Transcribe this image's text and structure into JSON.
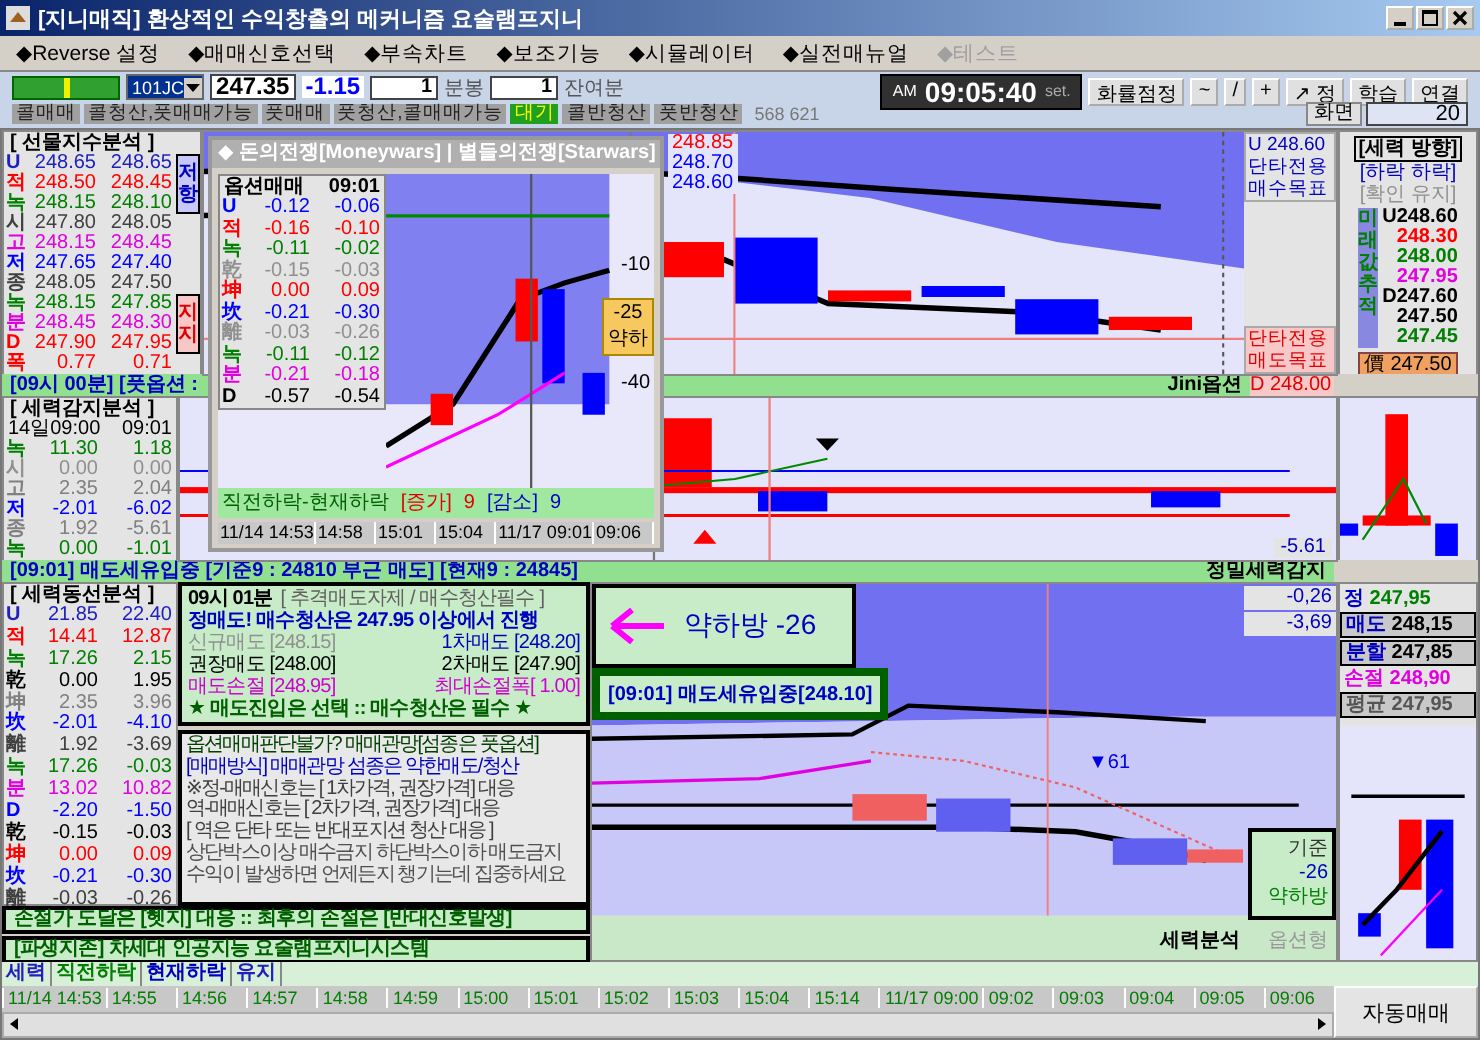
{
  "window": {
    "title": "[지니매직] 환상적인 수익창출의 메커니즘 요술램프지니"
  },
  "menu": [
    {
      "label": "◆Reverse 설정",
      "disabled": false
    },
    {
      "label": "◆매매신호선택",
      "disabled": false
    },
    {
      "label": "◆부속차트",
      "disabled": false
    },
    {
      "label": "◆보조기능",
      "disabled": false
    },
    {
      "label": "◆시뮬레이터",
      "disabled": false
    },
    {
      "label": "◆실전매뉴얼",
      "disabled": false
    },
    {
      "label": "◆테스트",
      "disabled": true
    }
  ],
  "toolbar": {
    "code": "101JC",
    "price": "247.35",
    "change": "-1.15",
    "bar_value": "1",
    "bar_label": "분봉",
    "remain_value": "1",
    "remain_label": "잔여분",
    "clock": {
      "ampm": "AM",
      "time": "09:05:40",
      "set": "set."
    },
    "buttons": [
      "화률점정",
      "~",
      "/",
      "+",
      "↗ 정",
      "학습",
      "연결"
    ]
  },
  "signals": [
    {
      "label": "콜매매",
      "selected": false
    },
    {
      "label": "콜청산,풋매매가능",
      "selected": false
    },
    {
      "label": "풋매매",
      "selected": false
    },
    {
      "label": "풋청산,콜매매가능",
      "selected": false
    },
    {
      "label": "대기",
      "selected": true
    },
    {
      "label": "콜반청산",
      "selected": false
    },
    {
      "label": "풋반청산",
      "selected": false
    }
  ],
  "signal_code": "568 621",
  "screen": {
    "label": "화면",
    "value": "20"
  },
  "futures_panel": {
    "title": "[ 선물지수분석 ]",
    "rows": [
      {
        "label": "U",
        "a": "248.65",
        "b": "248.65",
        "color": "#2020c0"
      },
      {
        "label": "적",
        "a": "248.50",
        "b": "248.45",
        "color": "#ff0000"
      },
      {
        "label": "녹",
        "a": "248.15",
        "b": "248.10",
        "color": "#008000"
      },
      {
        "label": "시",
        "a": "247.80",
        "b": "248.05",
        "color": "#404040"
      },
      {
        "label": "고",
        "a": "248.15",
        "b": "248.45",
        "color": "#e000e0"
      },
      {
        "label": "저",
        "a": "247.65",
        "b": "247.40",
        "color": "#0000ff"
      },
      {
        "label": "종",
        "a": "248.05",
        "b": "247.50",
        "color": "#404040"
      },
      {
        "label": "녹",
        "a": "248.15",
        "b": "247.85",
        "color": "#008000"
      },
      {
        "label": "분",
        "a": "248.45",
        "b": "248.30",
        "color": "#e000e0"
      },
      {
        "label": "D",
        "a": "247.90",
        "b": "247.95",
        "color": "#ff0000"
      },
      {
        "label": "폭",
        "a": "0.77",
        "b": "0.71",
        "color": "#ff0000"
      }
    ],
    "side_tags": [
      {
        "text": "저항",
        "kind": "resistance"
      },
      {
        "text": "지지",
        "kind": "support"
      }
    ]
  },
  "popup": {
    "title": "◆ 돈의전쟁[Moneywars] | 별들의전쟁[Starwars]",
    "head": {
      "label": "옵션매매",
      "time": "09:01"
    },
    "rows": [
      {
        "label": "U",
        "a": "-0.12",
        "b": "-0.06",
        "color": "#0000ff"
      },
      {
        "label": "적",
        "a": "-0.16",
        "b": "-0.10",
        "color": "#ff0000"
      },
      {
        "label": "녹",
        "a": "-0.11",
        "b": "-0.02",
        "color": "#008000"
      },
      {
        "label": "乾",
        "a": "-0.15",
        "b": "-0.03",
        "color": "#909090"
      },
      {
        "label": "坤",
        "a": "0.00",
        "b": "0.09",
        "color": "#ff0000"
      },
      {
        "label": "坎",
        "a": "-0.21",
        "b": "-0.30",
        "color": "#0000ff"
      },
      {
        "label": "離",
        "a": "-0.03",
        "b": "-0.26",
        "color": "#909090"
      },
      {
        "label": "녹",
        "a": "-0.11",
        "b": "-0.12",
        "color": "#008000"
      },
      {
        "label": "분",
        "a": "-0.21",
        "b": "-0.18",
        "color": "#e000e0"
      },
      {
        "label": "D",
        "a": "-0.57",
        "b": "-0.54",
        "color": "#000000"
      }
    ],
    "axis_labels": [
      "-10",
      "-40"
    ],
    "badge": {
      "value": "-25",
      "text": "약하"
    },
    "summary": {
      "text": "직전하락-현재하락",
      "up_label": "[증가]",
      "up_count": "9",
      "down_label": "[감소]",
      "down_count": "9"
    },
    "times": [
      "11/14 14:53",
      "14:58",
      "15:01",
      "15:04",
      "11/17 09:01",
      "09:06"
    ]
  },
  "main_chart": {
    "price_labels": [
      {
        "text": "248.85",
        "color": "#ff0000"
      },
      {
        "text": "248.70",
        "color": "#0000ff"
      },
      {
        "text": "248.60",
        "color": "#0000ff"
      }
    ],
    "targets_top": [
      "U 248.60",
      "단타전용",
      "매수목표"
    ],
    "targets_bottom": [
      "단타전용",
      "매도목표"
    ],
    "strip_left": "[09시 00분] [풋옵션 :",
    "strip_right": "Jini옵션",
    "bottom_target": "D 248.00"
  },
  "direction_panel": {
    "title": "[세력 방향]",
    "line1": "[하락 하락]",
    "line2": "[확인 유지]",
    "vertical": "미래값추적",
    "values": [
      {
        "text": "U248.60",
        "color": "#000000"
      },
      {
        "text": "248.30",
        "color": "#ff0000"
      },
      {
        "text": "248.00",
        "color": "#008000"
      },
      {
        "text": "247.95",
        "color": "#e000e0"
      },
      {
        "text": "D247.60",
        "color": "#000000"
      },
      {
        "text": "247.50",
        "color": "#000000"
      },
      {
        "text": "247.45",
        "color": "#008000"
      }
    ],
    "price_icon": "價",
    "price": "247.50"
  },
  "force_panel": {
    "title": "[ 세력감지분석 ]",
    "head": {
      "date": "14일09:00",
      "time": "09:01"
    },
    "rows": [
      {
        "label": "녹",
        "a": "11.30",
        "b": "1.18",
        "color": "#008000"
      },
      {
        "label": "시",
        "a": "0.00",
        "b": "0.00",
        "color": "#909090"
      },
      {
        "label": "고",
        "a": "2.35",
        "b": "2.04",
        "color": "#808080"
      },
      {
        "label": "저",
        "a": "-2.01",
        "b": "-6.02",
        "color": "#0000ff"
      },
      {
        "label": "종",
        "a": "1.92",
        "b": "-5.61",
        "color": "#808080"
      },
      {
        "label": "녹",
        "a": "0.00",
        "b": "-1.01",
        "color": "#008000"
      }
    ]
  },
  "force_chart": {
    "reading": "-5.61"
  },
  "alert_strip": {
    "text": "[09:01] 매도세유입중 [기준9 : 24810 부근 매도] [현재9 : 24845]",
    "label": "정밀세력감지"
  },
  "flow_panel": {
    "title": "[ 세력동선분석 ]",
    "rows": [
      {
        "label": "U",
        "a": "21.85",
        "b": "22.40",
        "color": "#2020c0"
      },
      {
        "label": "적",
        "a": "14.41",
        "b": "12.87",
        "color": "#ff0000"
      },
      {
        "label": "녹",
        "a": "17.26",
        "b": "2.15",
        "color": "#008000"
      },
      {
        "label": "乾",
        "a": "0.00",
        "b": "1.95",
        "color": "#000000"
      },
      {
        "label": "坤",
        "a": "2.35",
        "b": "3.96",
        "color": "#808080"
      },
      {
        "label": "坎",
        "a": "-2.01",
        "b": "-4.10",
        "color": "#0000ff"
      },
      {
        "label": "離",
        "a": "1.92",
        "b": "-3.69",
        "color": "#404040"
      },
      {
        "label": "녹",
        "a": "17.26",
        "b": "-0.03",
        "color": "#008000"
      },
      {
        "label": "분",
        "a": "13.02",
        "b": "10.82",
        "color": "#e000e0"
      },
      {
        "label": "D",
        "a": "-2.20",
        "b": "-1.50",
        "color": "#0000ff"
      },
      {
        "label": "乾",
        "a": "-0.15",
        "b": "-0.03",
        "color": "#000000"
      },
      {
        "label": "坤",
        "a": "0.00",
        "b": "0.09",
        "color": "#ff0000"
      },
      {
        "label": "坎",
        "a": "-0.21",
        "b": "-0.30",
        "color": "#0000ff"
      },
      {
        "label": "離",
        "a": "-0.03",
        "b": "-0.26",
        "color": "#404040"
      }
    ]
  },
  "advice": {
    "time": "09시 01분",
    "note": "[ 추격매도자제 / 매수청산필수 ]",
    "main": "정매도! 매수청산은 247.95 이상에서 진행",
    "prices": [
      {
        "left": "신규매도 [248.15]",
        "right": "1차매도 [248.20]",
        "color": "#909090"
      },
      {
        "left": "권장매도 [248.00]",
        "right": "2차매도 [247.90]",
        "color": "#000000"
      },
      {
        "left": "매도손절 [248.95]",
        "right": "최대손절폭[ 1.00]",
        "color": "#d000d0"
      }
    ],
    "slogan": "★ 매도진입은 선택 :: 매수청산은 필수 ★"
  },
  "guide": [
    {
      "text": "옵션매매판단불가? 매매관망[섬종은 풋옵션]",
      "color": "#004000"
    },
    {
      "text": "[매매방식] 매매관망 섬종은 약한매도/청산",
      "color": "#0000c0"
    },
    {
      "text": "※정-매매신호는 [ 1차가격, 권장가격] 대응",
      "color": "#404040"
    },
    {
      "text": "역-매매신호는 [ 2차가격, 권장가격] 대응",
      "color": "#404040"
    },
    {
      "text": "[ 역은 단타 또는 반대포지션 청산 대응 ]",
      "color": "#404040"
    },
    {
      "text": "상단박스이상 매수금지  하단박스이하 매도금지",
      "color": "#505050"
    },
    {
      "text": "수익이 발생하면 언제든지 챙기는데 집중하세요",
      "color": "#505050"
    }
  ],
  "notes": [
    "손절가 도달은 [헷지] 대응 :: 최후의 손절은 [반대신호발생]",
    "[파생지존] 차세대 인공지능 요술램프지니시스템"
  ],
  "signal_box": {
    "text": "약하방 -26"
  },
  "inflow_box": {
    "text": "[09:01] 매도세유입중[248.10]"
  },
  "flow_chart": {
    "marker": "▼61",
    "readings": [
      "-0,26",
      "-3,69"
    ],
    "result": {
      "label": "기준",
      "value": "-26",
      "text": "약하방"
    },
    "strip_label": "세력분석",
    "strip_right": "옵션형"
  },
  "order_panel": [
    {
      "label": "정",
      "value": "247,95",
      "kind": "plain"
    },
    {
      "label": "매도",
      "value": "248,15",
      "kind": "boxed"
    },
    {
      "label": "분할",
      "value": "247,85",
      "kind": "boxed"
    },
    {
      "label": "손절",
      "value": "248,90",
      "kind": "stop"
    },
    {
      "label": "평균",
      "value": "247,95",
      "kind": "muted"
    }
  ],
  "legend": [
    {
      "text": "세력",
      "color": "#2020c0"
    },
    {
      "text": "직전하락",
      "color": "#008000"
    },
    {
      "text": "현재하락",
      "color": "#0000c0"
    },
    {
      "text": "유지",
      "color": "#2020c0"
    }
  ],
  "time_axis": [
    "11/14 14:53",
    "14:55",
    "14:56",
    "14:57",
    "14:58",
    "14:59",
    "15:00",
    "15:01",
    "15:02",
    "15:03",
    "15:04",
    "15:14",
    "11/17 09:00",
    "09:02",
    "09:03",
    "09:04",
    "09:05",
    "09:06"
  ],
  "auto_trade": "자동매매"
}
